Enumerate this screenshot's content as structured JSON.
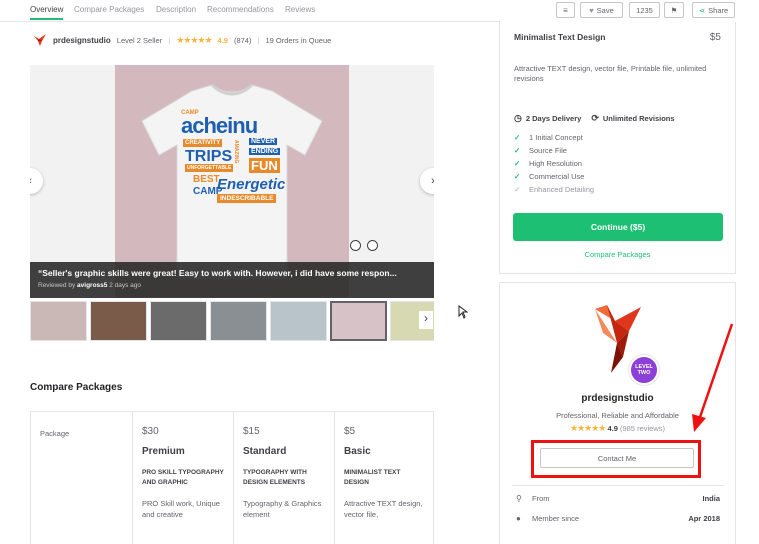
{
  "nav": {
    "tabs": [
      "Overview",
      "Compare Packages",
      "Description",
      "Recommendations",
      "Reviews"
    ],
    "save_label": "Save",
    "count": "1235",
    "share_label": "Share"
  },
  "seller_line": {
    "name": "prdesignstudio",
    "level": "Level 2 Seller",
    "rating": "4.9",
    "reviews": "(874)",
    "orders": "19 Orders in Queue"
  },
  "gallery": {
    "quote": "“Seller's graphic skills were great! Easy to work with. However, i did have some respon...",
    "reviewed_by_prefix": "Reviewed by",
    "reviewer": "avigross5",
    "reviewed_when": "2 days ago",
    "design_words": [
      "CAMP",
      "acheinu",
      "CREATIVITY",
      "NEVER",
      "ENDING",
      "TRIPS",
      "UNFORGETTABLE",
      "FUN",
      "BEST",
      "CAMP",
      "Energetic",
      "INDESCRIBABLE",
      "AMAZING"
    ]
  },
  "compare": {
    "title": "Compare Packages",
    "row_label": "Package",
    "packages": [
      {
        "price": "$30",
        "name": "Premium",
        "upper": "PRO SKILL TYPOGRAPHY AND GRAPHIC",
        "desc": "PRO Skill work, Unique and creative"
      },
      {
        "price": "$15",
        "name": "Standard",
        "upper": "TYPOGRAPHY WITH DESIGN ELEMENTS",
        "desc": "Typography & Graphics element"
      },
      {
        "price": "$5",
        "name": "Basic",
        "upper": "MINIMALIST TEXT DESIGN",
        "desc": "Attractive TEXT design, vector file,"
      }
    ]
  },
  "package_card": {
    "title": "Minimalist Text Design",
    "price": "$5",
    "description": "Attractive TEXT design, vector file, Printable file, unlimited revisions",
    "delivery": "2 Days Delivery",
    "revisions": "Unlimited Revisions",
    "features": [
      {
        "label": "1 Initial Concept",
        "included": true
      },
      {
        "label": "Source File",
        "included": true
      },
      {
        "label": "High Resolution",
        "included": true
      },
      {
        "label": "Commercial Use",
        "included": true
      },
      {
        "label": "Enhanced Detailing",
        "included": false
      }
    ],
    "continue_label": "Continue ($5)",
    "compare_label": "Compare Packages"
  },
  "seller_card": {
    "badge_line1": "LEVEL",
    "badge_line2": "TWO",
    "name": "prdesignstudio",
    "tagline": "Professional, Reliable and Affordable",
    "rating": "4.9",
    "reviews": "(985 reviews)",
    "contact_label": "Contact Me",
    "from_label": "From",
    "from_value": "India",
    "member_label": "Member since",
    "member_value": "Apr 2018"
  },
  "colors": {
    "accent": "#1dbf73",
    "star": "#ffb33e",
    "annotation": "#ee1111",
    "badge": "#8c40d8"
  }
}
